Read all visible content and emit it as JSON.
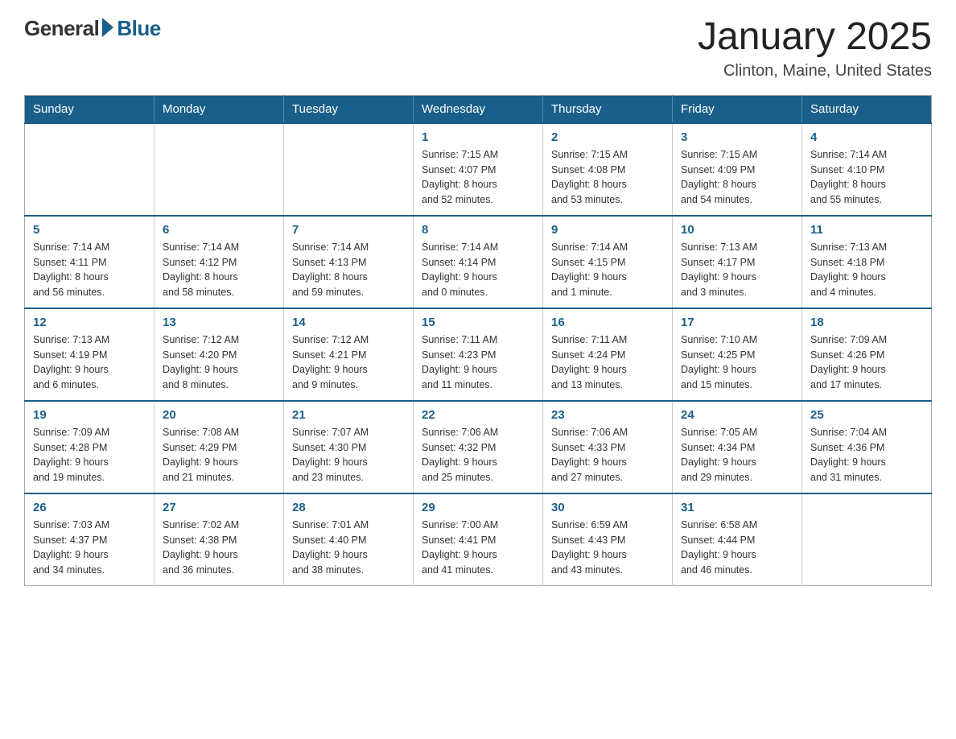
{
  "header": {
    "logo_general": "General",
    "logo_blue": "Blue",
    "month_title": "January 2025",
    "location": "Clinton, Maine, United States"
  },
  "days_of_week": [
    "Sunday",
    "Monday",
    "Tuesday",
    "Wednesday",
    "Thursday",
    "Friday",
    "Saturday"
  ],
  "weeks": [
    [
      {
        "day": "",
        "info": ""
      },
      {
        "day": "",
        "info": ""
      },
      {
        "day": "",
        "info": ""
      },
      {
        "day": "1",
        "info": "Sunrise: 7:15 AM\nSunset: 4:07 PM\nDaylight: 8 hours\nand 52 minutes."
      },
      {
        "day": "2",
        "info": "Sunrise: 7:15 AM\nSunset: 4:08 PM\nDaylight: 8 hours\nand 53 minutes."
      },
      {
        "day": "3",
        "info": "Sunrise: 7:15 AM\nSunset: 4:09 PM\nDaylight: 8 hours\nand 54 minutes."
      },
      {
        "day": "4",
        "info": "Sunrise: 7:14 AM\nSunset: 4:10 PM\nDaylight: 8 hours\nand 55 minutes."
      }
    ],
    [
      {
        "day": "5",
        "info": "Sunrise: 7:14 AM\nSunset: 4:11 PM\nDaylight: 8 hours\nand 56 minutes."
      },
      {
        "day": "6",
        "info": "Sunrise: 7:14 AM\nSunset: 4:12 PM\nDaylight: 8 hours\nand 58 minutes."
      },
      {
        "day": "7",
        "info": "Sunrise: 7:14 AM\nSunset: 4:13 PM\nDaylight: 8 hours\nand 59 minutes."
      },
      {
        "day": "8",
        "info": "Sunrise: 7:14 AM\nSunset: 4:14 PM\nDaylight: 9 hours\nand 0 minutes."
      },
      {
        "day": "9",
        "info": "Sunrise: 7:14 AM\nSunset: 4:15 PM\nDaylight: 9 hours\nand 1 minute."
      },
      {
        "day": "10",
        "info": "Sunrise: 7:13 AM\nSunset: 4:17 PM\nDaylight: 9 hours\nand 3 minutes."
      },
      {
        "day": "11",
        "info": "Sunrise: 7:13 AM\nSunset: 4:18 PM\nDaylight: 9 hours\nand 4 minutes."
      }
    ],
    [
      {
        "day": "12",
        "info": "Sunrise: 7:13 AM\nSunset: 4:19 PM\nDaylight: 9 hours\nand 6 minutes."
      },
      {
        "day": "13",
        "info": "Sunrise: 7:12 AM\nSunset: 4:20 PM\nDaylight: 9 hours\nand 8 minutes."
      },
      {
        "day": "14",
        "info": "Sunrise: 7:12 AM\nSunset: 4:21 PM\nDaylight: 9 hours\nand 9 minutes."
      },
      {
        "day": "15",
        "info": "Sunrise: 7:11 AM\nSunset: 4:23 PM\nDaylight: 9 hours\nand 11 minutes."
      },
      {
        "day": "16",
        "info": "Sunrise: 7:11 AM\nSunset: 4:24 PM\nDaylight: 9 hours\nand 13 minutes."
      },
      {
        "day": "17",
        "info": "Sunrise: 7:10 AM\nSunset: 4:25 PM\nDaylight: 9 hours\nand 15 minutes."
      },
      {
        "day": "18",
        "info": "Sunrise: 7:09 AM\nSunset: 4:26 PM\nDaylight: 9 hours\nand 17 minutes."
      }
    ],
    [
      {
        "day": "19",
        "info": "Sunrise: 7:09 AM\nSunset: 4:28 PM\nDaylight: 9 hours\nand 19 minutes."
      },
      {
        "day": "20",
        "info": "Sunrise: 7:08 AM\nSunset: 4:29 PM\nDaylight: 9 hours\nand 21 minutes."
      },
      {
        "day": "21",
        "info": "Sunrise: 7:07 AM\nSunset: 4:30 PM\nDaylight: 9 hours\nand 23 minutes."
      },
      {
        "day": "22",
        "info": "Sunrise: 7:06 AM\nSunset: 4:32 PM\nDaylight: 9 hours\nand 25 minutes."
      },
      {
        "day": "23",
        "info": "Sunrise: 7:06 AM\nSunset: 4:33 PM\nDaylight: 9 hours\nand 27 minutes."
      },
      {
        "day": "24",
        "info": "Sunrise: 7:05 AM\nSunset: 4:34 PM\nDaylight: 9 hours\nand 29 minutes."
      },
      {
        "day": "25",
        "info": "Sunrise: 7:04 AM\nSunset: 4:36 PM\nDaylight: 9 hours\nand 31 minutes."
      }
    ],
    [
      {
        "day": "26",
        "info": "Sunrise: 7:03 AM\nSunset: 4:37 PM\nDaylight: 9 hours\nand 34 minutes."
      },
      {
        "day": "27",
        "info": "Sunrise: 7:02 AM\nSunset: 4:38 PM\nDaylight: 9 hours\nand 36 minutes."
      },
      {
        "day": "28",
        "info": "Sunrise: 7:01 AM\nSunset: 4:40 PM\nDaylight: 9 hours\nand 38 minutes."
      },
      {
        "day": "29",
        "info": "Sunrise: 7:00 AM\nSunset: 4:41 PM\nDaylight: 9 hours\nand 41 minutes."
      },
      {
        "day": "30",
        "info": "Sunrise: 6:59 AM\nSunset: 4:43 PM\nDaylight: 9 hours\nand 43 minutes."
      },
      {
        "day": "31",
        "info": "Sunrise: 6:58 AM\nSunset: 4:44 PM\nDaylight: 9 hours\nand 46 minutes."
      },
      {
        "day": "",
        "info": ""
      }
    ]
  ]
}
